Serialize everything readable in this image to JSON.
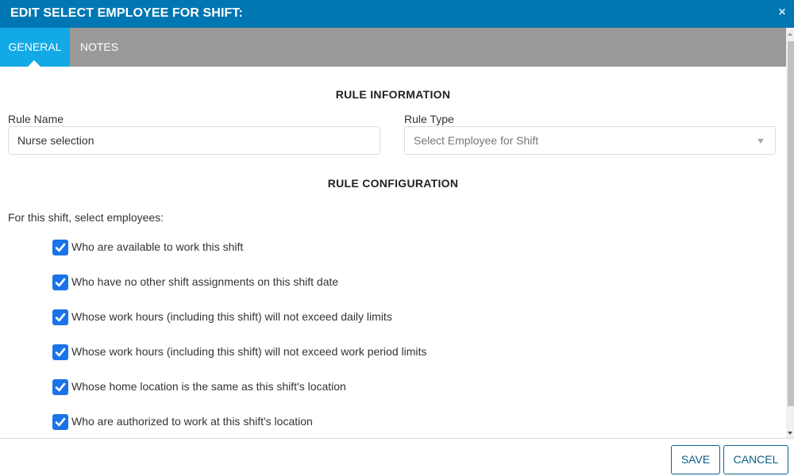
{
  "dialog": {
    "title": "EDIT SELECT EMPLOYEE FOR SHIFT:",
    "close_icon": "×"
  },
  "tabs": [
    {
      "label": "GENERAL",
      "active": true
    },
    {
      "label": "NOTES",
      "active": false
    }
  ],
  "rule_information": {
    "heading": "RULE INFORMATION",
    "rule_name_label": "Rule Name",
    "rule_name_value": "Nurse selection",
    "rule_type_label": "Rule Type",
    "rule_type_value": "Select Employee for Shift"
  },
  "rule_configuration": {
    "heading": "RULE CONFIGURATION",
    "intro": "For this shift, select employees:",
    "options": [
      {
        "label": "Who are available to work this shift",
        "checked": true
      },
      {
        "label": "Who have no other shift assignments on this shift date",
        "checked": true
      },
      {
        "label": "Whose work hours (including this shift) will not exceed daily limits",
        "checked": true
      },
      {
        "label": "Whose work hours (including this shift) will not exceed work period limits",
        "checked": true
      },
      {
        "label": "Whose home location is the same as this shift's location",
        "checked": true
      },
      {
        "label": "Who are authorized to work at this shift's location",
        "checked": true
      }
    ]
  },
  "footer": {
    "save_label": "SAVE",
    "cancel_label": "CANCEL"
  },
  "colors": {
    "titlebar": "#0077b3",
    "active_tab": "#12a9e6",
    "tabbar": "#999999",
    "checkbox": "#1a73e8",
    "button_border": "#0d5f8a"
  }
}
